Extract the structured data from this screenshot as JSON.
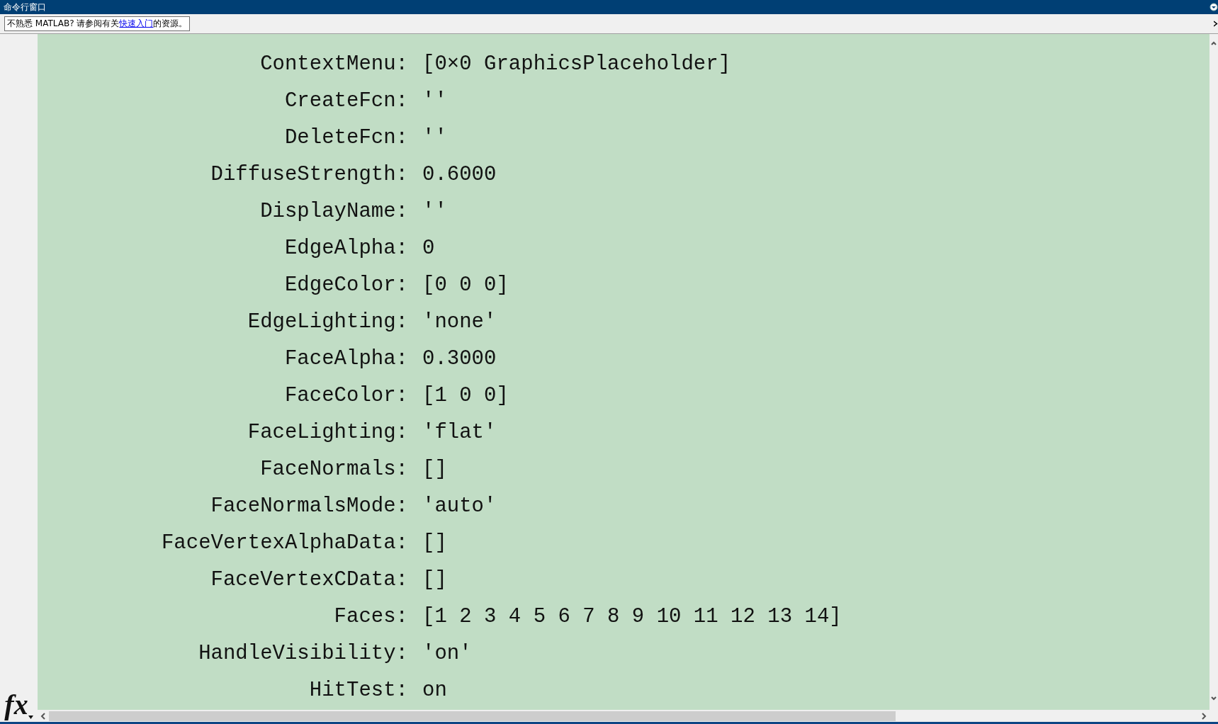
{
  "window": {
    "title": "命令行窗口"
  },
  "function_button": {
    "label": "fx"
  },
  "notice": {
    "text": "不熟悉 MATLAB? 请参阅有关",
    "link": "快速入门",
    "suffix": "的资源。"
  },
  "properties": [
    {
      "name": "ContextMenu:",
      "value": "[0×0 GraphicsPlaceholder]"
    },
    {
      "name": "CreateFcn:",
      "value": "''"
    },
    {
      "name": "DeleteFcn:",
      "value": "''"
    },
    {
      "name": "DiffuseStrength:",
      "value": "0.6000"
    },
    {
      "name": "DisplayName:",
      "value": "''"
    },
    {
      "name": "EdgeAlpha:",
      "value": "0"
    },
    {
      "name": "EdgeColor:",
      "value": "[0 0 0]"
    },
    {
      "name": "EdgeLighting:",
      "value": "'none'"
    },
    {
      "name": "FaceAlpha:",
      "value": "0.3000"
    },
    {
      "name": "FaceColor:",
      "value": "[1 0 0]"
    },
    {
      "name": "FaceLighting:",
      "value": "'flat'"
    },
    {
      "name": "FaceNormals:",
      "value": "[]"
    },
    {
      "name": "FaceNormalsMode:",
      "value": "'auto'"
    },
    {
      "name": "FaceVertexAlphaData:",
      "value": "[]"
    },
    {
      "name": "FaceVertexCData:",
      "value": "[]"
    },
    {
      "name": "Faces:",
      "value": "[1 2 3 4 5 6 7 8 9 10 11 12 13 14]"
    },
    {
      "name": "HandleVisibility:",
      "value": "'on'"
    },
    {
      "name": "HitTest:",
      "value": "on"
    }
  ]
}
